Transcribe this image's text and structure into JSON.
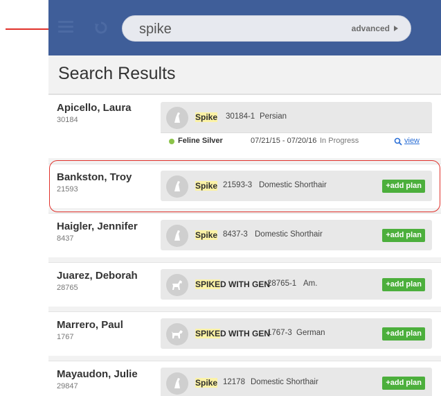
{
  "search": {
    "query": "spike",
    "advanced_label": "advanced"
  },
  "page": {
    "title": "Search Results"
  },
  "results": [
    {
      "owner": "Apicello, Laura",
      "owner_id": "30184",
      "pet_highlight": "Spike",
      "pet_rest": "",
      "pet_id": "30184-1",
      "breed": "Persian",
      "plan": {
        "name": "Feline Silver",
        "dates": "07/21/15 - 07/20/16",
        "status": "In Progress",
        "action": "view"
      }
    },
    {
      "owner": "Bankston, Troy",
      "owner_id": "21593",
      "pet_highlight": "Spike",
      "pet_rest": "",
      "pet_id": "21593-3",
      "breed": "Domestic Shorthair",
      "action": "+add plan"
    },
    {
      "owner": "Haigler, Jennifer",
      "owner_id": "8437",
      "pet_highlight": "Spike",
      "pet_rest": "",
      "pet_id": "8437-3",
      "breed": "Domestic Shorthair",
      "action": "+add plan"
    },
    {
      "owner": "Juarez, Deborah",
      "owner_id": "28765",
      "pet_highlight": "SPIKE",
      "pet_rest": "D WITH GEN",
      "pet_id": "28765-1",
      "breed": "Am.",
      "action": "+add plan"
    },
    {
      "owner": "Marrero, Paul",
      "owner_id": "1767",
      "pet_highlight": "SPIKE",
      "pet_rest": "D WITH GEN",
      "pet_id": "1767-3",
      "breed": "German",
      "action": "+add plan"
    },
    {
      "owner": "Mayaudon, Julie",
      "owner_id": "29847",
      "pet_highlight": "Spike",
      "pet_rest": "",
      "pet_id": "12178",
      "breed": "Domestic Shorthair",
      "action": "+add plan"
    }
  ],
  "colors": {
    "header": "#3f5e99",
    "add_plan": "#4caf3c",
    "highlight": "#fbf2a6",
    "annotation": "#e0312b",
    "active_dot": "#8bc34a"
  }
}
